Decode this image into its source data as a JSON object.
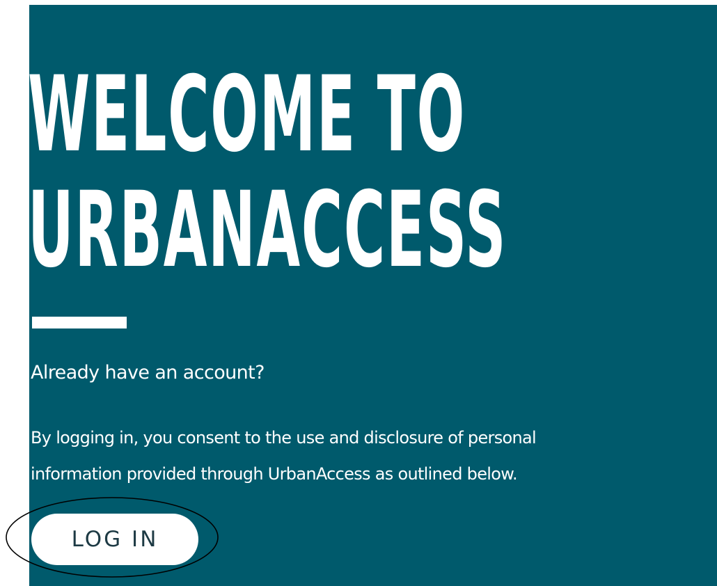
{
  "hero": {
    "title_line1": "WELCOME TO",
    "title_line2": "URBANACCESS"
  },
  "login_section": {
    "subheading": "Already have an account?",
    "consent_line1": "By logging in, you consent to the use and disclosure of personal",
    "consent_line2": "information provided through UrbanAccess as outlined below.",
    "login_button_label": "LOG IN"
  },
  "colors": {
    "panel_background": "#005a6c",
    "text": "#ffffff",
    "button_background": "#ffffff",
    "button_text": "#1d3a44",
    "annotation_outline": "#000000"
  }
}
